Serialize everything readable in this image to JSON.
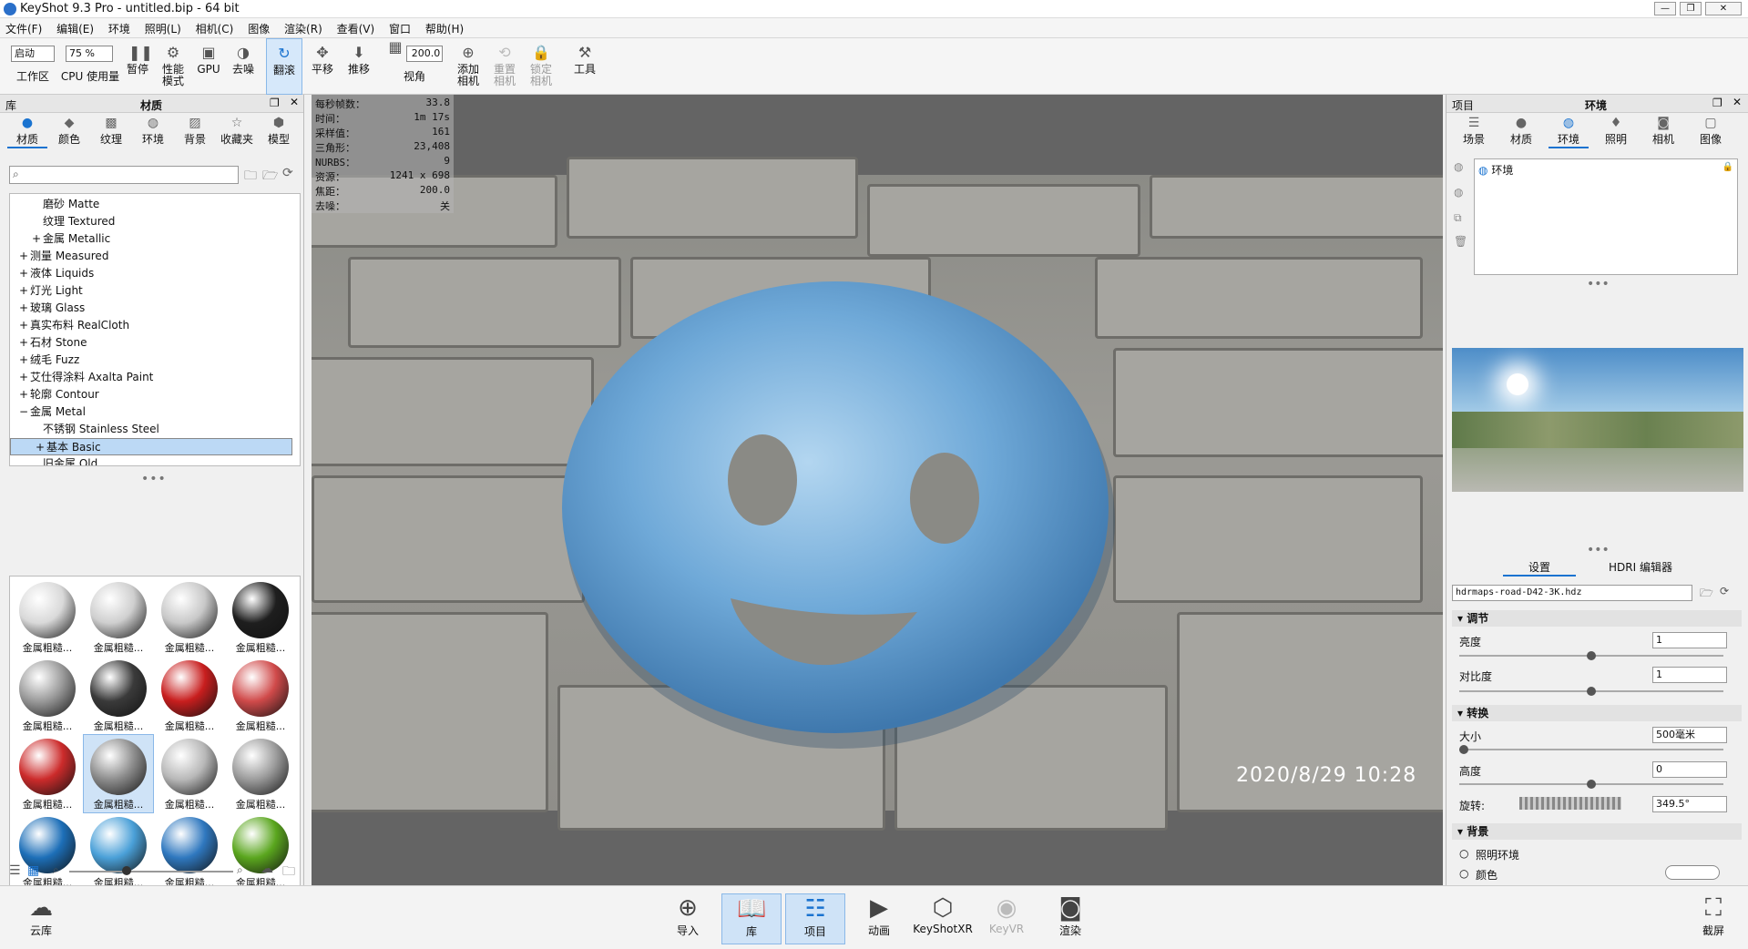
{
  "window": {
    "title": "KeyShot 9.3 Pro  - untitled.bip  - 64 bit"
  },
  "menu": [
    "文件(F)",
    "编辑(E)",
    "环境",
    "照明(L)",
    "相机(C)",
    "图像",
    "渲染(R)",
    "查看(V)",
    "窗口",
    "帮助(H)"
  ],
  "toolbar": {
    "workspace_select": "启动",
    "workspace_label": "工作区",
    "cpu_select": "75 %",
    "cpu_label": "CPU 使用量",
    "pause": "暂停",
    "perf_mode": "性能\n模式",
    "gpu": "GPU",
    "denoise": "去噪",
    "tumble": "翻滚",
    "pan": "平移",
    "dolly": "推移",
    "fov_value": "200.0",
    "fov_label": "视角",
    "add_camera": "添加\n相机",
    "reset_camera": "重置\n相机",
    "lock_camera": "锁定\n相机",
    "tools": "工具"
  },
  "library": {
    "header_left": "库",
    "header_title": "材质",
    "tabs": [
      "材质",
      "颜色",
      "纹理",
      "环境",
      "背景",
      "收藏夹",
      "模型"
    ],
    "tree": [
      {
        "label": "磨砂 Matte",
        "indent": 2,
        "expander": ""
      },
      {
        "label": "纹理 Textured",
        "indent": 2,
        "expander": ""
      },
      {
        "label": "金属 Metallic",
        "indent": 2,
        "expander": "+"
      },
      {
        "label": "测量 Measured",
        "indent": 1,
        "expander": "+"
      },
      {
        "label": "液体 Liquids",
        "indent": 1,
        "expander": "+"
      },
      {
        "label": "灯光 Light",
        "indent": 1,
        "expander": "+"
      },
      {
        "label": "玻璃 Glass",
        "indent": 1,
        "expander": "+"
      },
      {
        "label": "真实布料 RealCloth",
        "indent": 1,
        "expander": "+"
      },
      {
        "label": "石材 Stone",
        "indent": 1,
        "expander": "+"
      },
      {
        "label": "绒毛 Fuzz",
        "indent": 1,
        "expander": "+"
      },
      {
        "label": "艾仕得涂料 Axalta Paint",
        "indent": 1,
        "expander": "+"
      },
      {
        "label": "轮廓 Contour",
        "indent": 1,
        "expander": "+"
      },
      {
        "label": "金属 Metal",
        "indent": 1,
        "expander": "−"
      },
      {
        "label": "不锈钢 Stainless Steel",
        "indent": 2,
        "expander": ""
      },
      {
        "label": "基本 Basic",
        "indent": 2,
        "expander": "+",
        "selected": true
      },
      {
        "label": "旧金属 Old",
        "indent": 2,
        "expander": ""
      }
    ],
    "thumb_label": "金属粗糙...",
    "thumbs": [
      "#d9d9d9",
      "#cfcfcf",
      "#c8c8c8",
      "#1e1e1e",
      "#9a9a9a",
      "#3a3a3a",
      "#c81e1e",
      "#d04a4a",
      "#cc2b2b",
      "#8d8d8d",
      "#b8b8b8",
      "#9c9c9c",
      "#1d6fb8",
      "#4aa0d8",
      "#2f78bf",
      "#5aa61e",
      "#6cc02a",
      "#62b024",
      "#c4c4c4",
      "#bcbcbc"
    ]
  },
  "hud": [
    {
      "k": "每秒帧数：",
      "v": "33.8"
    },
    {
      "k": "时间：",
      "v": "1m 17s"
    },
    {
      "k": "采样值：",
      "v": "161"
    },
    {
      "k": "三角形：",
      "v": "23,408"
    },
    {
      "k": "NURBS：",
      "v": "9"
    },
    {
      "k": "资源：",
      "v": "1241 x 698"
    },
    {
      "k": "焦距：",
      "v": "200.0"
    },
    {
      "k": "去噪：",
      "v": "关"
    }
  ],
  "timestamp": "2020/8/29 10:28",
  "project": {
    "header_left": "项目",
    "header_title": "环境",
    "tabs": [
      "场景",
      "材质",
      "环境",
      "照明",
      "相机",
      "图像"
    ],
    "env_item": "环境",
    "subtabs": [
      "设置",
      "HDRI 编辑器"
    ],
    "hdri_file": "hdrmaps-road-D42-3K.hdz",
    "sections": {
      "adjust": "调节",
      "transform": "转换",
      "background": "背景"
    },
    "brightness_label": "亮度",
    "brightness": "1",
    "contrast_label": "对比度",
    "contrast": "1",
    "size_label": "大小",
    "size": "500毫米",
    "height_label": "高度",
    "height": "0",
    "rotation_label": "旋转:",
    "rotation": "349.5°",
    "bg_lighting": "照明环境",
    "bg_color": "颜色"
  },
  "bottom": [
    "云库",
    "导入",
    "库",
    "项目",
    "动画",
    "KeyShotXR",
    "KeyVR",
    "渲染",
    "截屏"
  ]
}
